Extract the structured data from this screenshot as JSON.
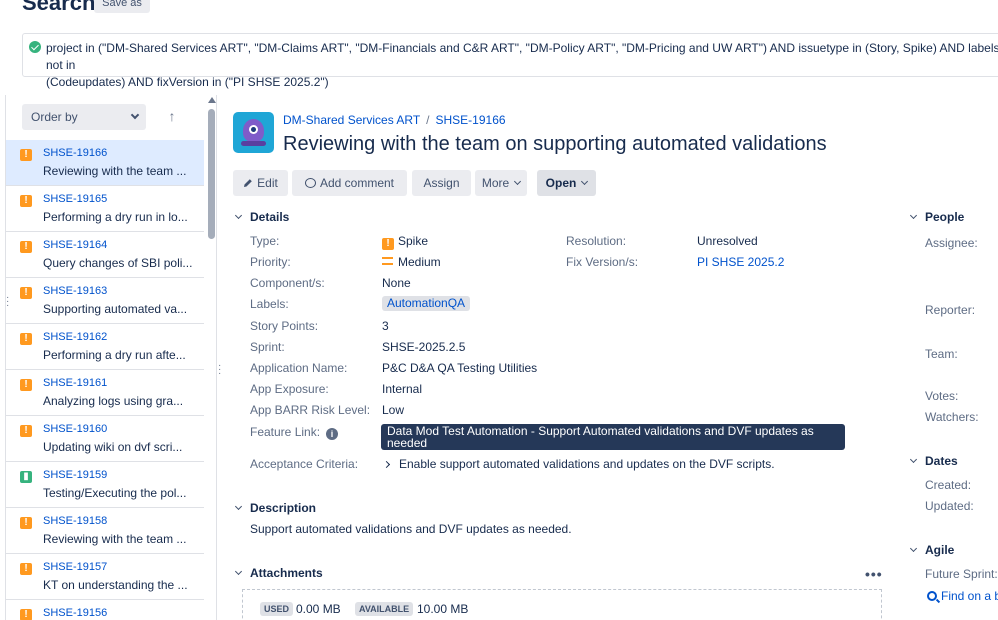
{
  "header": {
    "title": "Search",
    "save_as": "Save as",
    "jql": "project in (\"DM-Shared Services ART\", \"DM-Claims ART\", \"DM-Financials and C&R ART\", \"DM-Policy ART\", \"DM-Pricing and UW ART\") AND issuetype in (Story, Spike) AND labels not in\n(Codeupdates) AND fixVersion in (\"PI SHSE 2025.2\")"
  },
  "list": {
    "order_by": "Order by",
    "sort_arrow": "↑",
    "items": [
      {
        "key": "SHSE-19166",
        "summary": "Reviewing with the team ...",
        "type": "spike",
        "selected": true
      },
      {
        "key": "SHSE-19165",
        "summary": "Performing a dry run in lo...",
        "type": "spike"
      },
      {
        "key": "SHSE-19164",
        "summary": "Query changes of SBI poli...",
        "type": "spike"
      },
      {
        "key": "SHSE-19163",
        "summary": "Supporting automated va...",
        "type": "spike"
      },
      {
        "key": "SHSE-19162",
        "summary": "Performing a dry run afte...",
        "type": "spike"
      },
      {
        "key": "SHSE-19161",
        "summary": "Analyzing logs using gra...",
        "type": "spike"
      },
      {
        "key": "SHSE-19160",
        "summary": "Updating wiki on dvf scri...",
        "type": "spike"
      },
      {
        "key": "SHSE-19159",
        "summary": "Testing/Executing the pol...",
        "type": "story"
      },
      {
        "key": "SHSE-19158",
        "summary": "Reviewing with the team ...",
        "type": "spike"
      },
      {
        "key": "SHSE-19157",
        "summary": "KT on understanding the ...",
        "type": "spike"
      },
      {
        "key": "SHSE-19156",
        "summary": "",
        "type": "spike"
      }
    ]
  },
  "issue": {
    "project": "DM-Shared Services ART",
    "key": "SHSE-19166",
    "title": "Reviewing with the team on supporting automated validations",
    "toolbar": {
      "edit": "Edit",
      "add_comment": "Add comment",
      "assign": "Assign",
      "more": "More",
      "open": "Open"
    },
    "details_heading": "Details",
    "fields": {
      "type_label": "Type:",
      "type_value": "Spike",
      "priority_label": "Priority:",
      "priority_value": "Medium",
      "components_label": "Component/s:",
      "components_value": "None",
      "labels_label": "Labels:",
      "labels_value": "AutomationQA",
      "story_points_label": "Story Points:",
      "story_points_value": "3",
      "sprint_label": "Sprint:",
      "sprint_value": "SHSE-2025.2.5",
      "app_name_label": "Application Name:",
      "app_name_value": "P&C D&A QA Testing Utilities",
      "app_exposure_label": "App Exposure:",
      "app_exposure_value": "Internal",
      "barr_label": "App BARR Risk Level:",
      "barr_value": "Low",
      "feature_link_label": "Feature Link:",
      "feature_link_value": "Data Mod Test Automation - Support Automated validations and DVF updates as needed",
      "acceptance_label": "Acceptance Criteria:",
      "acceptance_value": "Enable support automated validations and updates on the DVF scripts.",
      "resolution_label": "Resolution:",
      "resolution_value": "Unresolved",
      "fix_version_label": "Fix Version/s:",
      "fix_version_value": "PI SHSE 2025.2"
    },
    "description_heading": "Description",
    "description": "Support automated validations and DVF updates as needed.",
    "attachments_heading": "Attachments",
    "attachments": {
      "used_label": "USED",
      "used_value": "0.00 MB",
      "available_label": "AVAILABLE",
      "available_value": "10.00 MB"
    }
  },
  "sidebar": {
    "people_heading": "People",
    "assignee": "Assignee:",
    "reporter": "Reporter:",
    "team": "Team:",
    "votes": "Votes:",
    "watchers": "Watchers:",
    "dates_heading": "Dates",
    "created": "Created:",
    "updated": "Updated:",
    "agile_heading": "Agile",
    "future_sprint": "Future Sprint:",
    "find_board": "Find on a b"
  }
}
